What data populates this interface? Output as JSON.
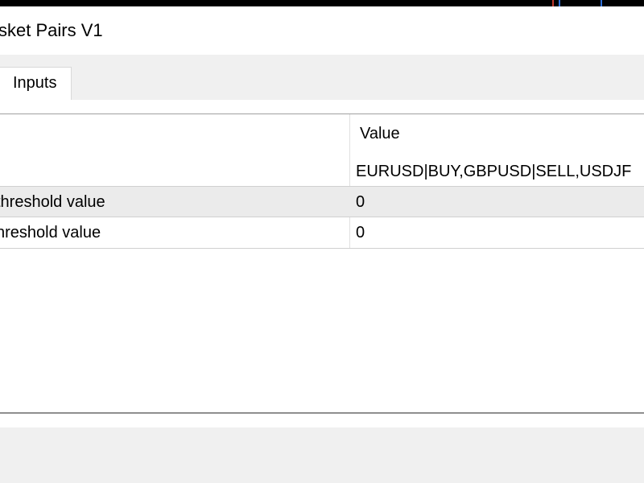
{
  "window": {
    "title": "sket Pairs V1"
  },
  "tabs": [
    {
      "label": "Inputs"
    }
  ],
  "grid": {
    "value_header": "Value",
    "rows": [
      {
        "name": "",
        "value": "EURUSD|BUY,GBPUSD|SELL,USDJF"
      },
      {
        "name": " threshold value",
        "value": "0"
      },
      {
        "name": "hreshold value",
        "value": "0"
      }
    ]
  },
  "colors": {
    "selected_row": "#ebebeb",
    "background": "#f0f0f0",
    "panel": "#ffffff"
  }
}
